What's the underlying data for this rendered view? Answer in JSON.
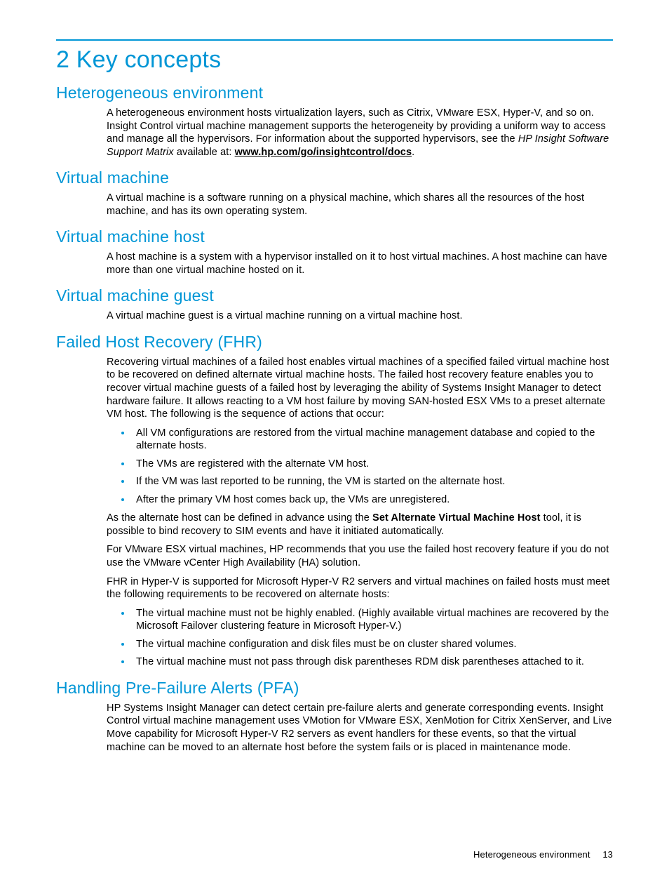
{
  "title": "2 Key concepts",
  "sections": {
    "hetero": {
      "heading": "Heterogeneous environment",
      "p1a": "A heterogeneous environment hosts virtualization layers, such as Citrix, VMware ESX, Hyper-V, and so on. Insight Control virtual machine management supports the heterogeneity by providing a uniform way to access and manage all the hypervisors. For information about the supported hypervisors, see the ",
      "p1_italic": "HP Insight Software Support Matrix",
      "p1b": " available at: ",
      "p1_link": "www.hp.com/go/insightcontrol/docs",
      "p1c": "."
    },
    "vm": {
      "heading": "Virtual machine",
      "p1": "A virtual machine is a software running on a physical machine, which shares all the resources of the host machine, and has its own operating system."
    },
    "vmhost": {
      "heading": "Virtual machine host",
      "p1": "A host machine is a system with a hypervisor installed on it to host virtual machines. A host machine can have more than one virtual machine hosted on it."
    },
    "vmguest": {
      "heading": "Virtual machine guest",
      "p1": "A virtual machine guest is a virtual machine running on a virtual machine host."
    },
    "fhr": {
      "heading": "Failed Host Recovery (FHR)",
      "p1": "Recovering virtual machines of a failed host enables virtual machines of a specified failed virtual machine host to be recovered on defined alternate virtual machine hosts. The failed host recovery feature enables you to recover virtual machine guests of a failed host by leveraging the ability of Systems Insight Manager to detect hardware failure. It allows reacting to a VM host failure by moving SAN-hosted ESX VMs to a preset alternate VM host. The following is the sequence of actions that occur:",
      "list1": {
        "i0": "All VM configurations are restored from the virtual machine management database and copied to the alternate hosts.",
        "i1": "The VMs are registered with the alternate VM host.",
        "i2": "If the VM was last reported to be running, the VM is started on the alternate host.",
        "i3": "After the primary VM host comes back up, the VMs are unregistered."
      },
      "p2a": "As the alternate host can be defined in advance using the ",
      "p2_bold": "Set Alternate Virtual Machine Host",
      "p2b": " tool, it is possible to bind recovery to SIM events and have it initiated automatically.",
      "p3": "For VMware ESX virtual machines, HP recommends that you use the failed host recovery feature if you do not use the VMware vCenter High Availability (HA) solution.",
      "p4": "FHR in Hyper-V is supported for Microsoft Hyper-V R2 servers and virtual machines on failed hosts must meet the following requirements to be recovered on alternate hosts:",
      "list2": {
        "i0": "The virtual machine must not be highly enabled. (Highly available virtual machines are recovered by the Microsoft Failover clustering feature in Microsoft Hyper-V.)",
        "i1": "The virtual machine configuration and disk files must be on cluster shared volumes.",
        "i2": "The virtual machine must not pass through disk parentheses RDM disk parentheses attached to it."
      }
    },
    "pfa": {
      "heading": "Handling Pre-Failure Alerts (PFA)",
      "p1": "HP Systems Insight Manager can detect certain pre-failure alerts and generate corresponding events. Insight Control virtual machine management uses VMotion for VMware ESX, XenMotion for Citrix XenServer, and Live Move capability for Microsoft Hyper-V R2 servers as event handlers for these events, so that the virtual machine can be moved to an alternate host before the system fails or is placed in maintenance mode."
    }
  },
  "footer": {
    "label": "Heterogeneous environment",
    "page": "13"
  }
}
